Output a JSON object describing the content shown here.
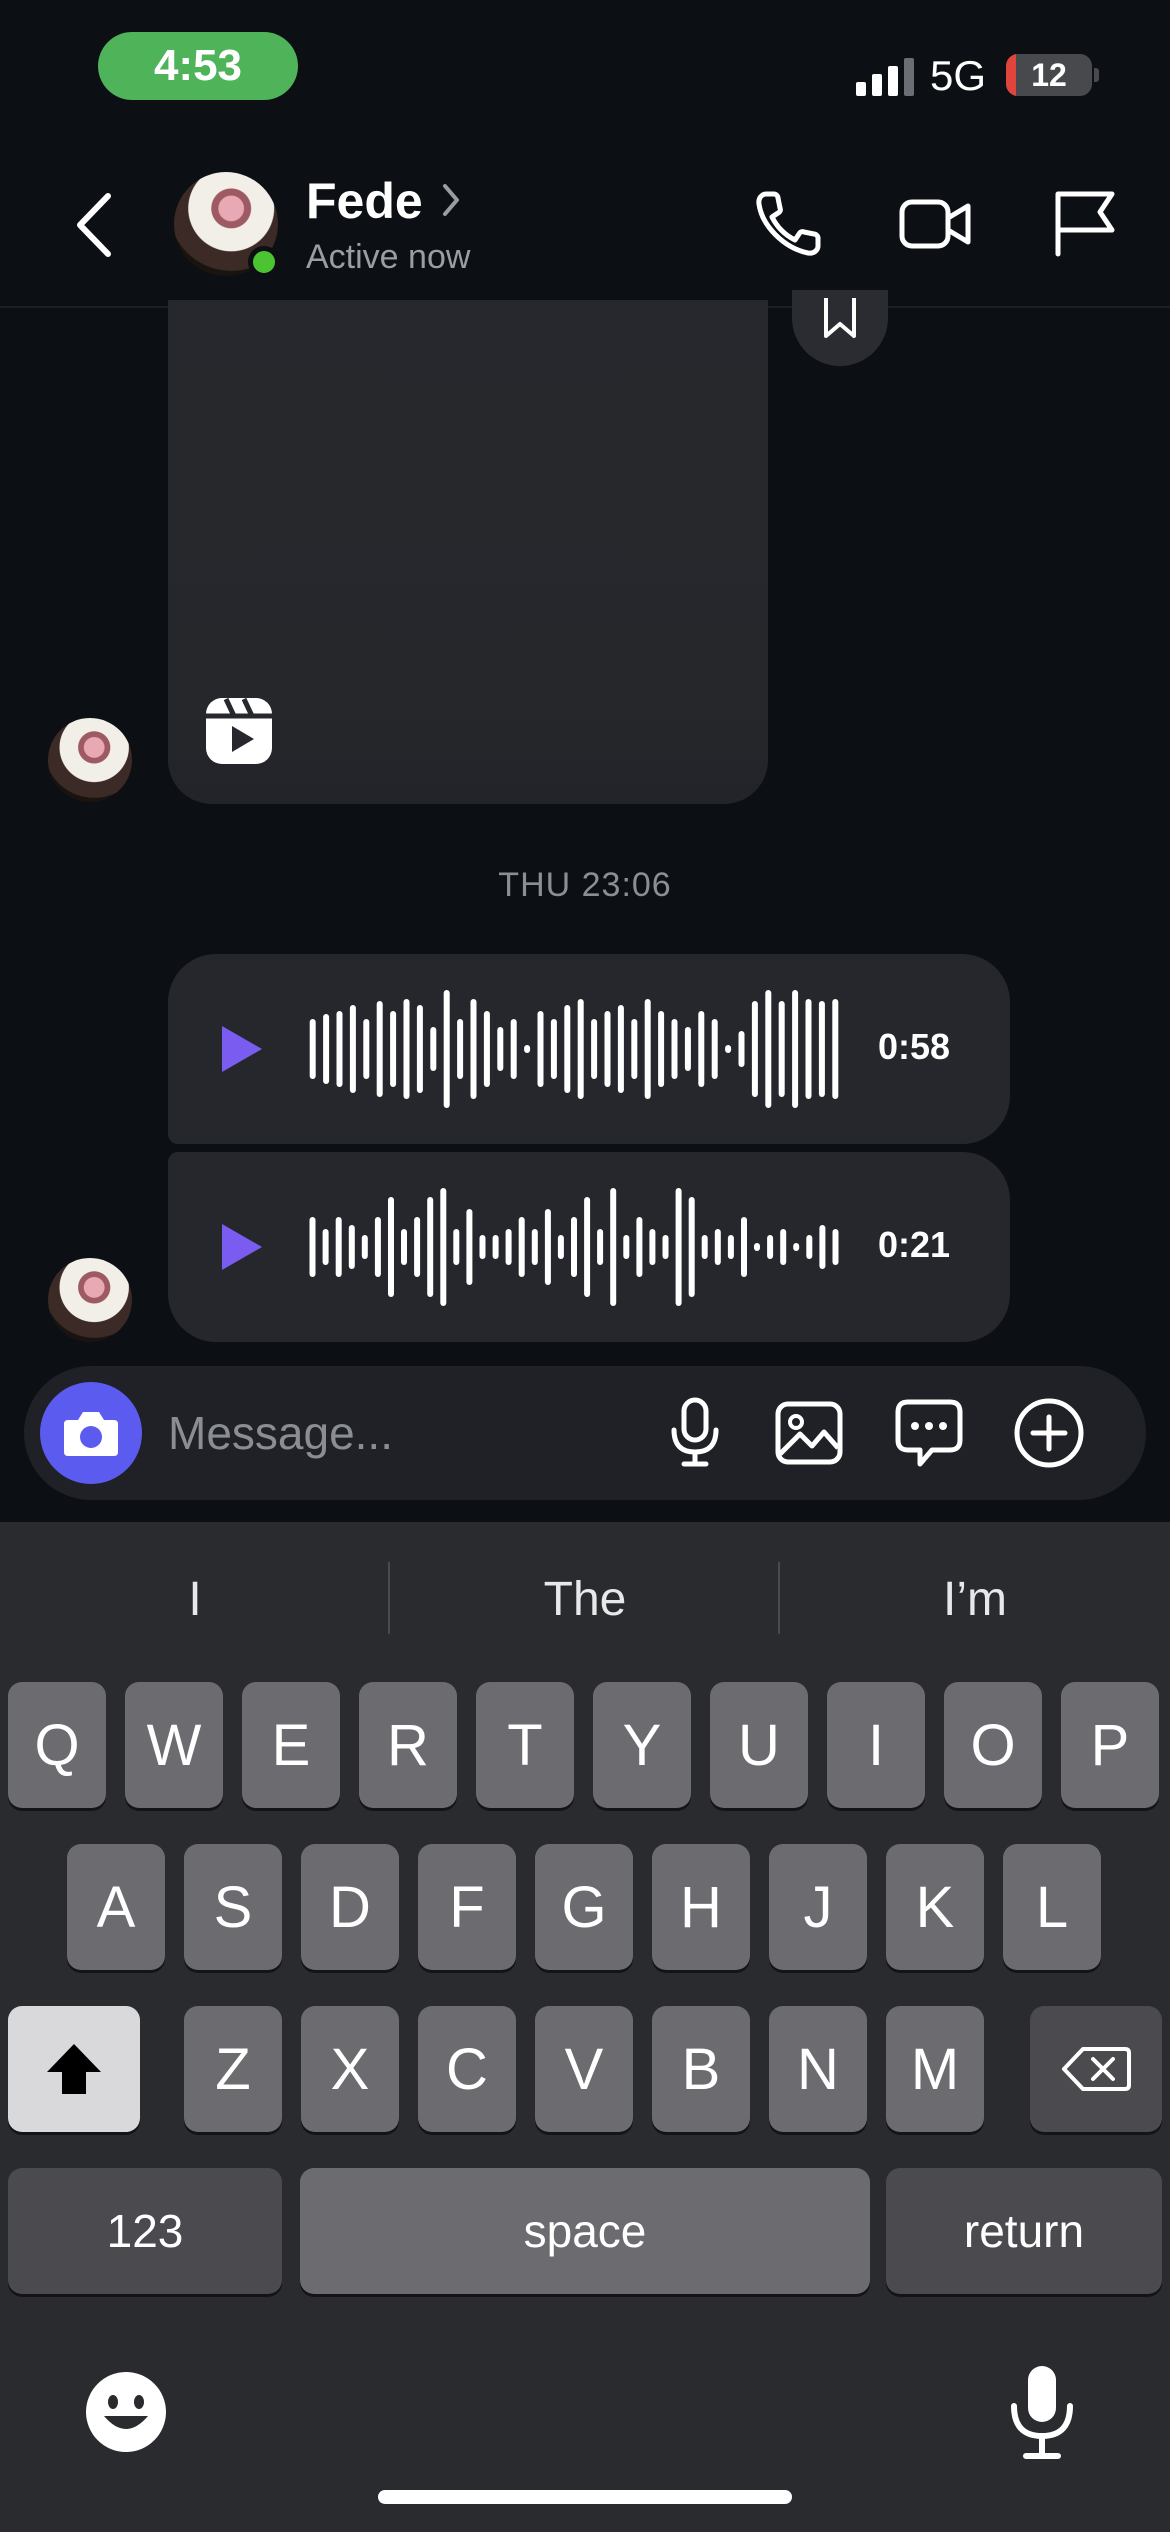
{
  "status_bar": {
    "time": "4:53",
    "network": "5G",
    "battery": "12",
    "battery_level_pct": 12
  },
  "header": {
    "name": "Fede",
    "status": "Active now",
    "accent_online": "#4cc432"
  },
  "chat": {
    "timestamp": "THU 23:06",
    "voice_messages": [
      {
        "duration": "0:58"
      },
      {
        "duration": "0:21"
      }
    ],
    "play_color": "#7a5cf0"
  },
  "composer": {
    "placeholder": "Message...",
    "camera_color": "#5b5bf0"
  },
  "keyboard": {
    "suggestions": [
      "I",
      "The",
      "I’m"
    ],
    "row1": [
      "Q",
      "W",
      "E",
      "R",
      "T",
      "Y",
      "U",
      "I",
      "O",
      "P"
    ],
    "row2": [
      "A",
      "S",
      "D",
      "F",
      "G",
      "H",
      "J",
      "K",
      "L"
    ],
    "row3": [
      "Z",
      "X",
      "C",
      "V",
      "B",
      "N",
      "M"
    ],
    "numbers_label": "123",
    "space_label": "space",
    "return_label": "return"
  }
}
